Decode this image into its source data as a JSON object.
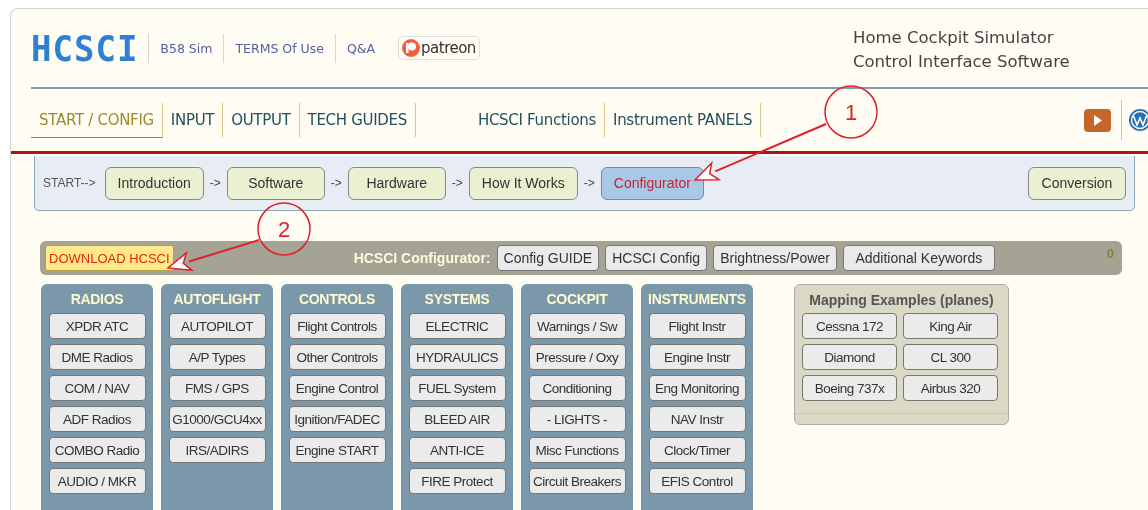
{
  "header": {
    "logo": "HCSCI",
    "links": [
      "B58 Sim",
      "TERMS Of Use",
      "Q&A"
    ],
    "sponsor_badge": "patreon",
    "tagline": [
      "Home Cockpit Simulator",
      "Control Interface Software"
    ]
  },
  "nav": {
    "main_tabs": [
      {
        "label": "START / CONFIG",
        "selected": true
      },
      {
        "label": "INPUT",
        "selected": false
      },
      {
        "label": "OUTPUT",
        "selected": false
      },
      {
        "label": "TECH GUIDES",
        "selected": false
      }
    ],
    "function_tabs": [
      {
        "label": "HCSCI Functions",
        "selected": false
      },
      {
        "label": "Instrument PANELS",
        "selected": false
      }
    ]
  },
  "breadcrumb": {
    "start_label": "START-->",
    "steps": [
      {
        "label": "Introduction",
        "selected": false
      },
      {
        "label": "Software",
        "selected": false
      },
      {
        "label": "Hardware",
        "selected": false
      },
      {
        "label": "How It Works",
        "selected": false
      },
      {
        "label": "Configurator",
        "selected": true
      }
    ],
    "separator": "->",
    "extra": "Conversion"
  },
  "configurator_bar": {
    "download": "DOWNLOAD HCSCI",
    "title": "HCSCI Configurator:",
    "buttons": [
      "Config GUIDE",
      "HCSCI Config",
      "Brightness/Power",
      "Additional Keywords"
    ],
    "count": "0"
  },
  "categories": [
    {
      "title": "RADIOS",
      "items": [
        "XPDR ATC",
        "DME Radios",
        "COM / NAV",
        "ADF Radios",
        "COMBO Radio",
        "AUDIO / MKR"
      ]
    },
    {
      "title": "AUTOFLIGHT",
      "items": [
        "AUTOPILOT",
        "A/P Types",
        "FMS / GPS",
        "G1000/GCU4xx",
        "IRS/ADIRS"
      ]
    },
    {
      "title": "CONTROLS",
      "items": [
        "Flight Controls",
        "Other Controls",
        "Engine Control",
        "Ignition/FADEC",
        "Engine START"
      ]
    },
    {
      "title": "SYSTEMS",
      "items": [
        "ELECTRIC",
        "HYDRAULICS",
        "FUEL System",
        "BLEED AIR",
        "ANTI-ICE",
        "FIRE Protect"
      ]
    },
    {
      "title": "COCKPIT",
      "items": [
        "Warnings / Sw",
        "Pressure / Oxy",
        "Conditioning",
        "- LIGHTS -",
        "Misc Functions",
        "Circuit Breakers"
      ]
    },
    {
      "title": "INSTRUMENTS",
      "items": [
        "Flight Instr",
        "Engine Instr",
        "Eng Monitoring",
        "NAV Instr",
        "Clock/Timer",
        "EFIS Control"
      ]
    }
  ],
  "mapping_examples": {
    "title": "Mapping Examples (planes)",
    "items": [
      "Cessna 172",
      "King Air",
      "Diamond",
      "CL 300",
      "Boeing 737x",
      "Airbus 320"
    ]
  },
  "annotations": [
    {
      "number": "1"
    },
    {
      "number": "2"
    }
  ]
}
